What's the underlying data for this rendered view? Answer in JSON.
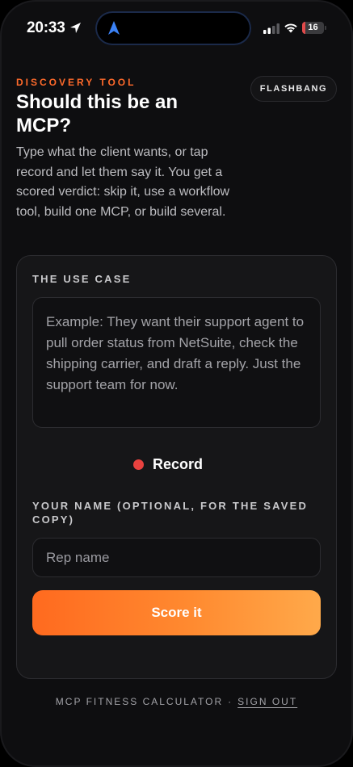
{
  "status_bar": {
    "time": "20:33",
    "battery_level": "16",
    "battery_color": "#e04a4a",
    "icons": [
      "location-arrow-icon",
      "navigation-arrow-icon",
      "cellular-signal-icon",
      "wifi-icon",
      "battery-icon"
    ]
  },
  "header": {
    "eyebrow": "DISCOVERY TOOL",
    "title": "Should this be an MCP?",
    "subtitle": "Type what the client wants, or tap record and let them say it. You get a scored verdict: skip it, use a workflow tool, build one MCP, or build several.",
    "brand": "FLASHBANG"
  },
  "form": {
    "use_case_label": "THE USE CASE",
    "use_case_placeholder": "Example: They want their support agent to pull order status from NetSuite, check the shipping carrier, and draft a reply. Just the support team for now.",
    "record_label": "Record",
    "name_label": "YOUR NAME (OPTIONAL, FOR THE SAVED COPY)",
    "name_placeholder": "Rep name",
    "submit_label": "Score it"
  },
  "footer": {
    "app_name": "MCP FITNESS CALCULATOR",
    "separator": "·",
    "sign_out": "SIGN OUT"
  },
  "colors": {
    "accent": "#ff6a2b",
    "button_gradient_start": "#ff6a1f",
    "button_gradient_end": "#ffa94a",
    "record_dot": "#e8423f",
    "background": "#0e0e10",
    "card": "#161618"
  }
}
